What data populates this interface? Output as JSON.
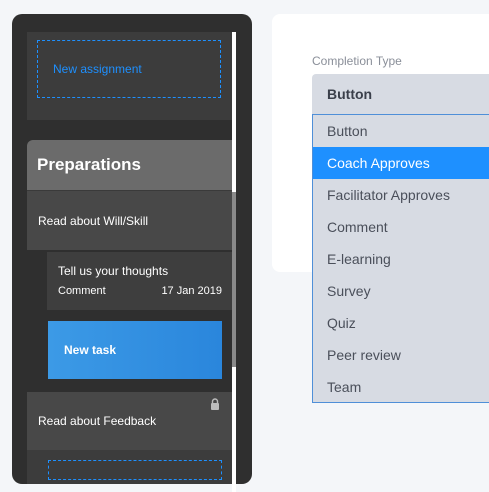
{
  "assignments": {
    "new_assignment_label": "New assignment"
  },
  "section": {
    "title": "Preparations",
    "tasks": [
      {
        "label": "Read about Will/Skill"
      },
      {
        "label": "Read about Feedback",
        "locked": true
      }
    ],
    "subtask": {
      "title": "Tell us your thoughts",
      "type": "Comment",
      "date": "17 Jan 2019"
    },
    "new_task_label": "New task"
  },
  "completion": {
    "label": "Completion Type",
    "selected_value": "Button",
    "options": [
      "Button",
      "Coach Approves",
      "Facilitator Approves",
      "Comment",
      "E-learning",
      "Survey",
      "Quiz",
      "Peer review",
      "Team"
    ],
    "highlighted_option": "Coach Approves"
  },
  "colors": {
    "accent": "#1e90ff",
    "panel_dark": "#2f2f2f",
    "dropdown_bg": "#d7dbe3"
  }
}
